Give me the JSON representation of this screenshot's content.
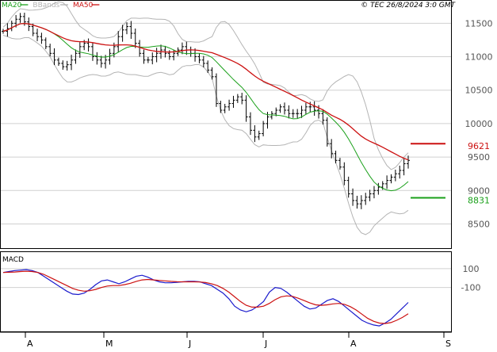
{
  "chart_data": [
    {
      "type": "ohlc",
      "copyright": "© TEC 26/8/2024 3:0 GMT",
      "legend": [
        {
          "label": "MA20",
          "color": "#1aa01a"
        },
        {
          "label": "BBands",
          "color": "#b4b4b4"
        },
        {
          "label": "MA50",
          "color": "#cc1111"
        }
      ],
      "y_ticks": [
        8500,
        9000,
        9500,
        10000,
        10500,
        11000,
        11500
      ],
      "y_tick_labels": [
        "8500",
        "9000",
        "9500",
        "10000",
        "10500",
        "11000",
        "11500"
      ],
      "ylim": [
        8150,
        11800
      ],
      "x_months": [
        "A",
        "M",
        "J",
        "J",
        "A",
        "S"
      ],
      "price_markers": [
        {
          "label": "9621",
          "value": 9700,
          "color": "#cc1111"
        },
        {
          "label": "8831",
          "value": 8890,
          "color": "#1aa01a"
        }
      ],
      "close": [
        11380,
        11420,
        11500,
        11560,
        11600,
        11520,
        11450,
        11350,
        11300,
        11250,
        11150,
        11050,
        10950,
        10900,
        10850,
        10880,
        10950,
        11050,
        11150,
        11200,
        11150,
        11000,
        10950,
        10900,
        10950,
        11050,
        11150,
        11300,
        11400,
        11450,
        11350,
        11200,
        11050,
        10950,
        10950,
        11000,
        11050,
        11100,
        11050,
        11000,
        11050,
        11100,
        11150,
        11100,
        11050,
        11000,
        10950,
        10900,
        10800,
        10700,
        10300,
        10200,
        10250,
        10300,
        10350,
        10400,
        10350,
        10100,
        9900,
        9800,
        9850,
        10000,
        10100,
        10150,
        10200,
        10250,
        10200,
        10150,
        10150,
        10150,
        10200,
        10250,
        10250,
        10200,
        10150,
        10050,
        9700,
        9550,
        9450,
        9350,
        9150,
        8950,
        8850,
        8800,
        8850,
        8900,
        8950,
        9000,
        9050,
        9100,
        9150,
        9200,
        9250,
        9300,
        9400,
        9450
      ]
    },
    {
      "type": "line",
      "title": "MACD",
      "y_ticks": [
        100,
        -100
      ],
      "y_tick_labels": [
        "100",
        "-100"
      ],
      "ylim": [
        -560,
        260
      ],
      "series": [
        {
          "color": "#1a1acc",
          "values": [
            60,
            70,
            80,
            85,
            90,
            80,
            60,
            20,
            -20,
            -60,
            -100,
            -140,
            -170,
            -175,
            -160,
            -120,
            -70,
            -30,
            -20,
            -40,
            -60,
            -40,
            -10,
            20,
            30,
            10,
            -20,
            -40,
            -50,
            -50,
            -45,
            -40,
            -35,
            -35,
            -40,
            -60,
            -80,
            -120,
            -160,
            -220,
            -300,
            -340,
            -360,
            -340,
            -300,
            -250,
            -150,
            -100,
            -110,
            -150,
            -200,
            -250,
            -300,
            -330,
            -320,
            -280,
            -240,
            -220,
            -250,
            -300,
            -350,
            -400,
            -450,
            -480,
            -500,
            -510,
            -480,
            -440,
            -380,
            -320,
            -260
          ]
        },
        {
          "color": "#cc1111",
          "values": [
            60,
            62,
            65,
            70,
            72,
            70,
            60,
            40,
            10,
            -20,
            -50,
            -80,
            -110,
            -130,
            -140,
            -135,
            -120,
            -100,
            -85,
            -80,
            -80,
            -70,
            -55,
            -35,
            -20,
            -15,
            -20,
            -25,
            -30,
            -35,
            -38,
            -40,
            -40,
            -40,
            -42,
            -48,
            -60,
            -80,
            -110,
            -150,
            -200,
            -250,
            -290,
            -310,
            -310,
            -300,
            -270,
            -230,
            -200,
            -190,
            -195,
            -215,
            -240,
            -265,
            -285,
            -290,
            -285,
            -275,
            -270,
            -280,
            -305,
            -340,
            -385,
            -430,
            -460,
            -480,
            -485,
            -475,
            -450,
            -420,
            -380
          ]
        }
      ]
    }
  ]
}
